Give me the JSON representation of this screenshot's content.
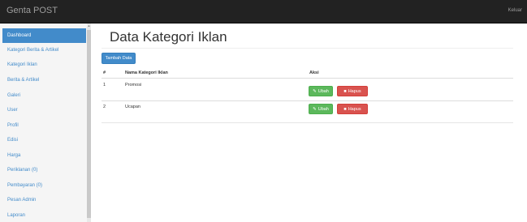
{
  "navbar": {
    "brand": "Genta POST",
    "logout_label": "Keluar"
  },
  "sidebar": {
    "items": [
      {
        "label": "Dashboard",
        "active": true
      },
      {
        "label": "Kategori Berita & Artikel",
        "active": false
      },
      {
        "label": "Kategori Iklan",
        "active": false
      },
      {
        "label": "Berita & Artikel",
        "active": false
      },
      {
        "label": "Galeri",
        "active": false
      },
      {
        "label": "User",
        "active": false
      },
      {
        "label": "Profil",
        "active": false
      },
      {
        "label": "Edisi",
        "active": false
      },
      {
        "label": "Harga",
        "active": false
      },
      {
        "label": "Periklanan (0)",
        "active": false
      },
      {
        "label": "Pembayaran (0)",
        "active": false
      },
      {
        "label": "Pesan Admin",
        "active": false
      },
      {
        "label": "Laporan",
        "active": false
      }
    ]
  },
  "main": {
    "title": "Data Kategori Iklan",
    "add_button": "Tambah Data",
    "table": {
      "headers": [
        "#",
        "Nama Kategori Iklan",
        "Aksi"
      ],
      "rows": [
        {
          "no": "1",
          "name": "Promosi"
        },
        {
          "no": "2",
          "name": "Ucapan"
        }
      ],
      "edit_label": "Ubah",
      "delete_label": "Hapus"
    }
  },
  "colors": {
    "navbar": "#222222",
    "primary": "#428bca",
    "success": "#5cb85c",
    "danger": "#d9534f"
  },
  "icons": {
    "edit": "pencil-icon",
    "delete": "trash-icon"
  }
}
